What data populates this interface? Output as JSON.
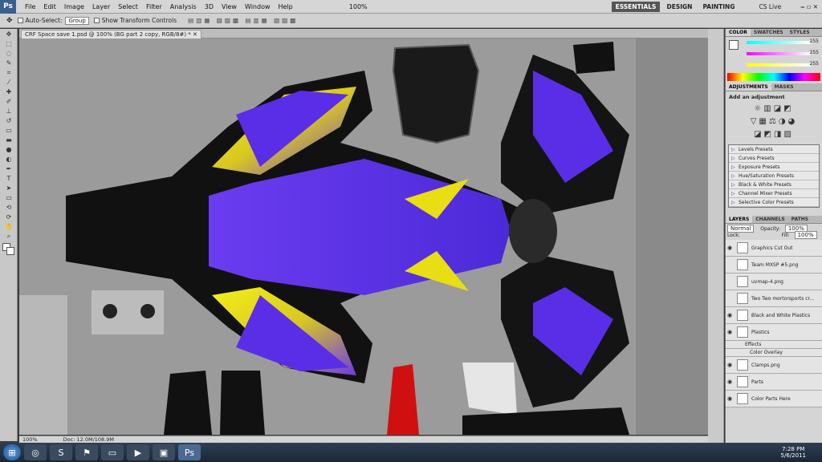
{
  "app": {
    "logo": "Ps"
  },
  "menu": [
    "File",
    "Edit",
    "Image",
    "Layer",
    "Select",
    "Filter",
    "Analysis",
    "3D",
    "View",
    "Window",
    "Help"
  ],
  "zoom_select": "100%",
  "workspaces": [
    "ESSENTIALS",
    "DESIGN",
    "PAINTING"
  ],
  "cs_live": "CS Live",
  "options": {
    "auto_select": "Auto-Select:",
    "auto_select_value": "Group",
    "transform": "Show Transform Controls"
  },
  "document_tab": "CRF Space save 1.psd @ 100% (BG part 2 copy, RGB/8#) *",
  "status": {
    "zoom": "100%",
    "doc": "Doc: 12.0M/108.9M"
  },
  "color_panel": {
    "tabs": [
      "COLOR",
      "SWATCHES",
      "STYLES"
    ],
    "r": "255",
    "g": "255",
    "b": "255"
  },
  "adjustments": {
    "tabs": [
      "ADJUSTMENTS",
      "MASKS"
    ],
    "heading": "Add an adjustment",
    "presets": [
      "Levels Presets",
      "Curves Presets",
      "Exposure Presets",
      "Hue/Saturation Presets",
      "Black & White Presets",
      "Channel Mixer Presets",
      "Selective Color Presets"
    ]
  },
  "layers_panel": {
    "tabs": [
      "LAYERS",
      "CHANNELS",
      "PATHS"
    ],
    "blend": "Normal",
    "opacity_label": "Opacity:",
    "opacity": "100%",
    "lock_label": "Lock:",
    "fill_label": "Fill:",
    "fill": "100%",
    "layers": [
      "Graphics Cut Out",
      "Team MXSP #5.png",
      "uvmap-4.png",
      "Two Two mortorsports cr...",
      "Black and White Plastics",
      "Plastics",
      "Effects",
      "Color Overlay",
      "Clamps.png",
      "Parts",
      "Color Parts Here"
    ]
  },
  "clock": {
    "time": "7:28 PM",
    "date": "5/6/2011"
  }
}
